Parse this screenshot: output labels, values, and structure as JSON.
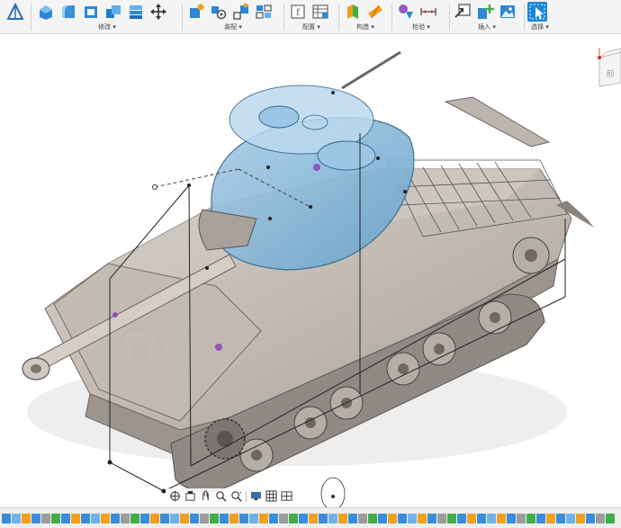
{
  "toolbar": {
    "groups": [
      {
        "label": "修改 ▾"
      },
      {
        "label": "装配 ▾"
      },
      {
        "label": "配置 ▾"
      },
      {
        "label": "构造 ▾"
      },
      {
        "label": "检验 ▾"
      },
      {
        "label": "插入 ▾"
      },
      {
        "label": "选择 ▾"
      }
    ]
  },
  "viewcube": {
    "face_label": "前"
  },
  "colors": {
    "selection_blue": "#1a86d8",
    "turret_highlight": "#7fb3d6",
    "hull": "#c9c2b9",
    "track": "#8f8a84",
    "sketch_line": "#222222"
  },
  "icons": [
    "sketch-icon",
    "press-pull-icon",
    "fillet-icon",
    "shell-icon",
    "combine-icon",
    "offset-face-icon",
    "move-icon",
    "new-component-icon",
    "joint-icon",
    "as-built-joint-icon",
    "rigid-group-icon",
    "parameters-icon",
    "configuration-table-icon",
    "offset-plane-icon",
    "plane-at-angle-icon",
    "measure-icon",
    "interference-icon",
    "section-analysis-icon",
    "insert-derive-icon",
    "insert-mesh-icon",
    "attached-canvas-icon",
    "select-icon",
    "orbit-icon",
    "look-at-icon",
    "pan-icon",
    "zoom-icon",
    "fit-icon",
    "display-settings-icon",
    "grid-icon",
    "viewports-icon"
  ]
}
